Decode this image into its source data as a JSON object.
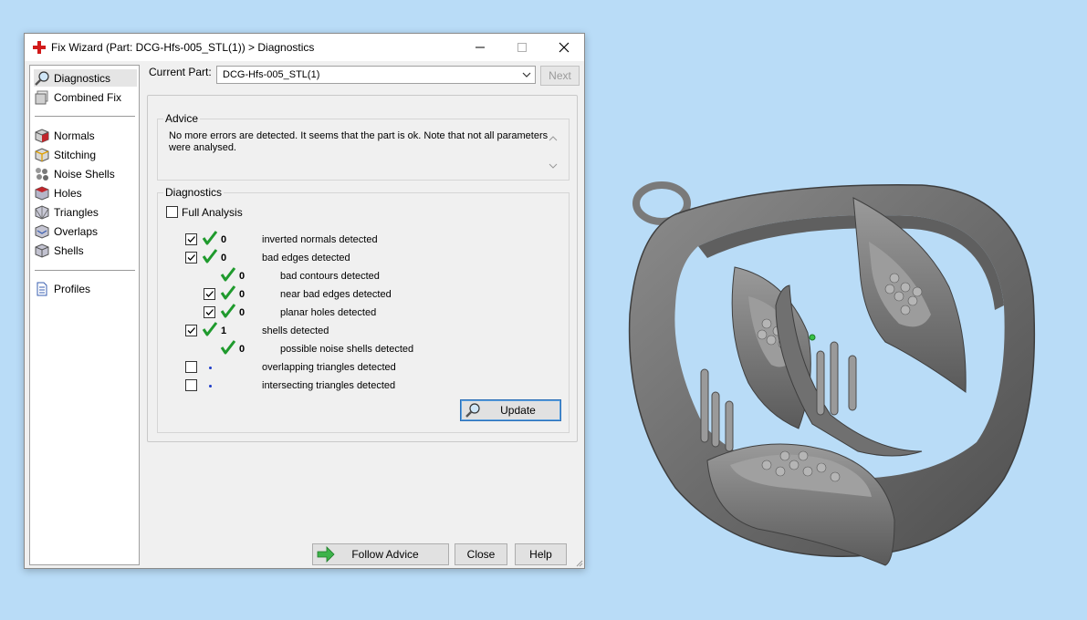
{
  "window": {
    "title": "Fix Wizard (Part: DCG-Hfs-005_STL(1)) > Diagnostics"
  },
  "sidebar": {
    "items": [
      {
        "label": "Diagnostics",
        "icon": "magnifier-icon"
      },
      {
        "label": "Combined Fix",
        "icon": "combined-fix-icon"
      },
      {
        "label": "Normals",
        "icon": "normals-cube-icon"
      },
      {
        "label": "Stitching",
        "icon": "stitching-cube-icon"
      },
      {
        "label": "Noise Shells",
        "icon": "noise-shells-icon"
      },
      {
        "label": "Holes",
        "icon": "holes-cube-icon"
      },
      {
        "label": "Triangles",
        "icon": "triangles-cube-icon"
      },
      {
        "label": "Overlaps",
        "icon": "overlaps-cube-icon"
      },
      {
        "label": "Shells",
        "icon": "shells-cube-icon"
      },
      {
        "label": "Profiles",
        "icon": "profiles-doc-icon"
      }
    ]
  },
  "current_part": {
    "label": "Current Part:",
    "value": "DCG-Hfs-005_STL(1)",
    "next_label": "Next"
  },
  "advice": {
    "title": "Advice",
    "text": "No more errors are detected. It seems that the part is ok. Note that not all parameters were analysed."
  },
  "diagnostics": {
    "title": "Diagnostics",
    "full_analysis_label": "Full Analysis",
    "rows": [
      {
        "count": "0",
        "label": "inverted normals detected"
      },
      {
        "count": "0",
        "label": "bad edges detected"
      },
      {
        "count": "0",
        "label": "bad contours detected"
      },
      {
        "count": "0",
        "label": "near bad edges detected"
      },
      {
        "count": "0",
        "label": "planar holes detected"
      },
      {
        "count": "1",
        "label": "shells detected"
      },
      {
        "count": "0",
        "label": "possible noise shells detected"
      },
      {
        "count": "",
        "label": "overlapping triangles detected"
      },
      {
        "count": "",
        "label": "intersecting triangles detected"
      }
    ],
    "update_label": "Update"
  },
  "footer": {
    "follow_advice_label": "Follow Advice",
    "close_label": "Close",
    "help_label": "Help"
  },
  "colors": {
    "desktop": "#b9dcf7",
    "check_green": "#1f9a2d",
    "update_border": "#2a6fb8",
    "app_red": "#d11a1a"
  }
}
